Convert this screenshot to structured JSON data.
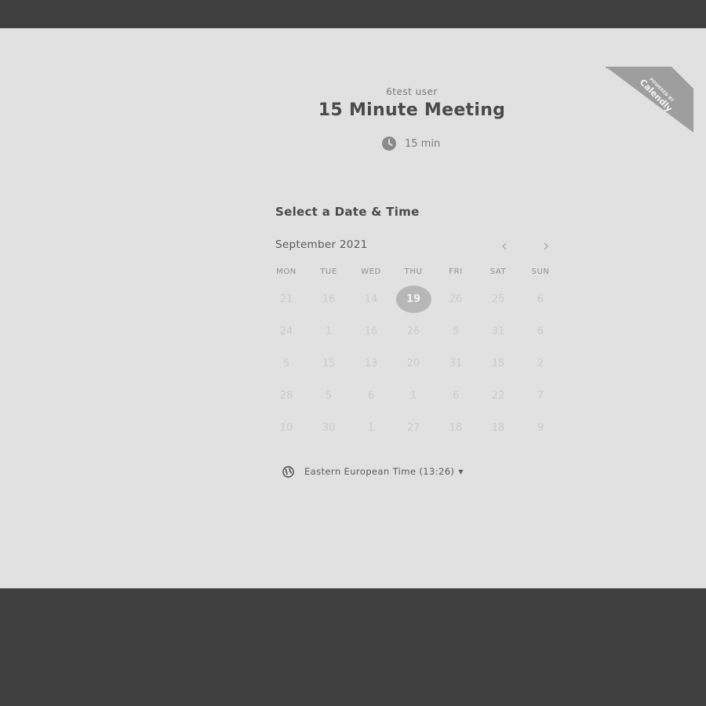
{
  "event": {
    "host": "6test user",
    "title": "15 Minute Meeting",
    "duration": "15 min",
    "duration_icon": "clock-icon"
  },
  "calendar": {
    "heading": "Select a Date & Time",
    "month_label": "September 2021",
    "prev_icon": "chevron-left-icon",
    "next_icon": "chevron-right-icon",
    "weekdays": [
      "MON",
      "TUE",
      "WED",
      "THU",
      "FRI",
      "SAT",
      "SUN"
    ],
    "weeks": [
      [
        "21",
        "16",
        "14",
        "19",
        "26",
        "25",
        "6"
      ],
      [
        "24",
        "1",
        "16",
        "26",
        "5",
        "31",
        "6"
      ],
      [
        "5",
        "15",
        "13",
        "20",
        "31",
        "15",
        "2"
      ],
      [
        "28",
        "5",
        "6",
        "1",
        "6",
        "22",
        "7"
      ],
      [
        "10",
        "30",
        "1",
        "27",
        "18",
        "18",
        "9"
      ]
    ],
    "selected_day": "19"
  },
  "timezone": {
    "label": "Eastern European Time (13:26)",
    "icon": "globe-icon"
  },
  "badge": {
    "line1": "POWERED BY",
    "line2": "Calendly"
  }
}
